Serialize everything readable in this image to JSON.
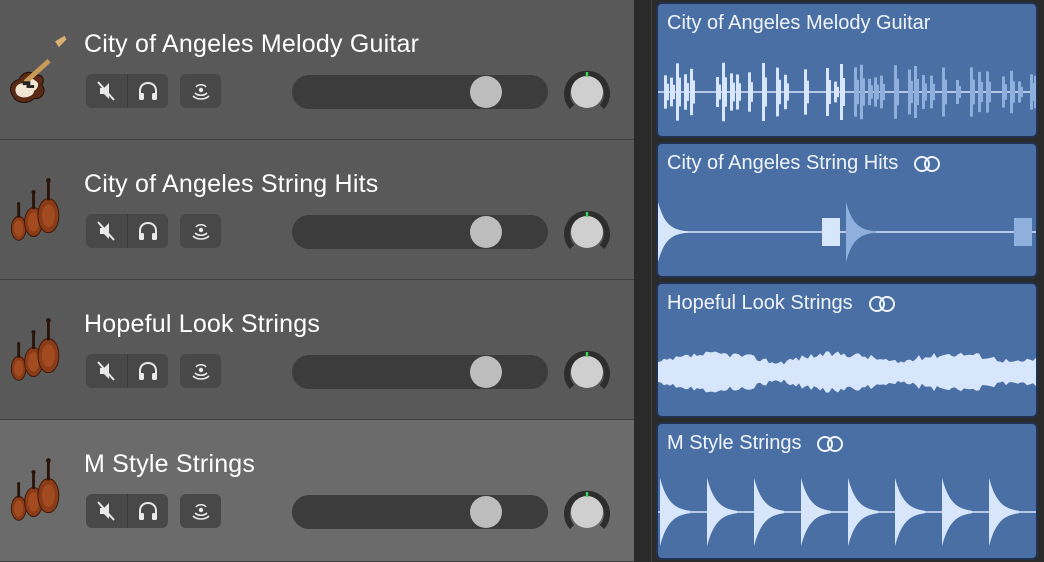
{
  "tracks": [
    {
      "name": "City of Angeles Melody Guitar",
      "icon": "electric-guitar-icon",
      "volume": 0.8,
      "selected": false
    },
    {
      "name": "City of Angeles String Hits",
      "icon": "strings-icon",
      "volume": 0.8,
      "selected": false
    },
    {
      "name": "Hopeful Look Strings",
      "icon": "strings-icon",
      "volume": 0.8,
      "selected": false
    },
    {
      "name": "M Style Strings",
      "icon": "strings-icon",
      "volume": 0.8,
      "selected": true
    }
  ],
  "regions": [
    {
      "title": "City of Angeles Melody Guitar",
      "loop": false,
      "wave": "hits"
    },
    {
      "title": "City of Angeles String Hits",
      "loop": true,
      "wave": "swells"
    },
    {
      "title": "Hopeful Look Strings",
      "loop": true,
      "wave": "pad"
    },
    {
      "title": "M Style Strings",
      "loop": true,
      "wave": "pulses"
    }
  ],
  "colors": {
    "region_fill": "#4a6fa4",
    "waveform": "#d8e6fb",
    "waveform_loop": "#8fb0dc",
    "header_bg": "#595959",
    "header_selected_bg": "#6b6b6b",
    "pan_indicator": "#3fd15a"
  }
}
